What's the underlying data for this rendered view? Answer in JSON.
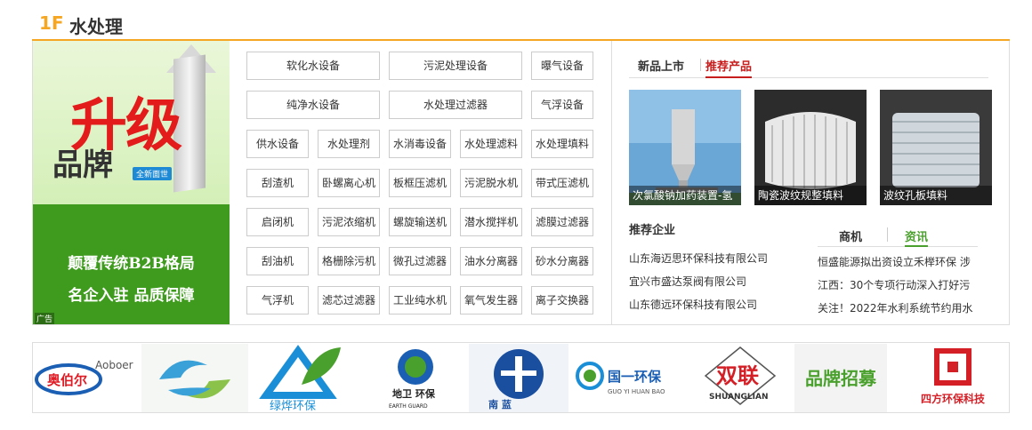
{
  "floor": {
    "number": "1F",
    "title": "水处理"
  },
  "banner": {
    "headline": "升级",
    "brand": "品牌",
    "brand_tag": "全新面世",
    "slogan1": "颠覆传统B2B格局",
    "slogan2": "名企入驻 品质保障",
    "ad_label": "广告"
  },
  "categories": [
    [
      "软化水设备",
      "污泥处理设备",
      "曝气设备"
    ],
    [
      "纯净水设备",
      "水处理过滤器",
      "气浮设备"
    ],
    [
      "供水设备",
      "水处理剂",
      "水消毒设备",
      "水处理滤料",
      "水处理填料"
    ],
    [
      "刮渣机",
      "卧螺离心机",
      "板框压滤机",
      "污泥脱水机",
      "带式压滤机"
    ],
    [
      "启闭机",
      "污泥浓缩机",
      "螺旋输送机",
      "潜水搅拌机",
      "滤膜过滤器"
    ],
    [
      "刮油机",
      "格栅除污机",
      "微孔过滤器",
      "油水分离器",
      "砂水分离器"
    ],
    [
      "气浮机",
      "滤芯过滤器",
      "工业纯水机",
      "氧气发生器",
      "离子交换器"
    ]
  ],
  "product_tabs": {
    "new": "新品上市",
    "recommended": "推荐产品"
  },
  "products": [
    {
      "caption": "次氯酸钠加药装置-氢"
    },
    {
      "caption": "陶瓷波纹规整填料"
    },
    {
      "caption": "波纹孔板填料"
    }
  ],
  "recommended_companies": {
    "title": "推荐企业",
    "items": [
      "山东海迈思环保科技有限公司",
      "宜兴市盛达泵阀有限公司",
      "山东德远环保科技有限公司"
    ]
  },
  "news_tabs": {
    "business": "商机",
    "info": "资讯"
  },
  "news": [
    "恒盛能源拟出资设立禾榉环保 涉",
    "江西：30个专项行动深入打好污",
    "关注！2022年水利系统节约用水"
  ],
  "logos": [
    {
      "name": "Aoboer",
      "cn": "奥伯尔"
    },
    {
      "name": "",
      "cn": ""
    },
    {
      "name": "",
      "cn": "绿烨环保"
    },
    {
      "name": "EARTH GUARD",
      "cn": "地卫 环保"
    },
    {
      "name": "",
      "cn": "南 蓝"
    },
    {
      "name": "GUO YI HUAN BAO",
      "cn": "国一环保"
    },
    {
      "name": "SHUANGLIAN",
      "cn": "双联"
    },
    {
      "name": "",
      "cn": "品牌招募"
    },
    {
      "name": "",
      "cn": "四方环保科技"
    }
  ],
  "colors": {
    "accent": "#f5a623",
    "red": "#c81d1d",
    "green": "#4aa02c"
  }
}
